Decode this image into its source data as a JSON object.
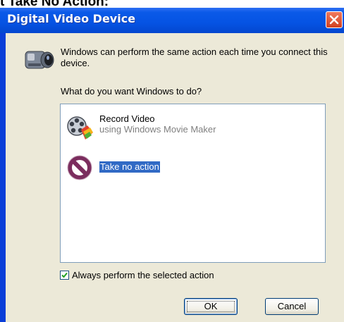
{
  "background_caption": "t Take No Action:",
  "dialog": {
    "title": "Digital Video Device",
    "message": "Windows can perform the same action each time you connect this device.",
    "question": "What do you want Windows to do?",
    "actions": [
      {
        "title": "Record Video",
        "subtitle": "using Windows Movie Maker",
        "icon": "movie-maker-icon",
        "selected": false
      },
      {
        "title": "Take no action",
        "icon": "no-action-icon",
        "selected": true
      }
    ],
    "always_checkbox": {
      "label": "Always perform the selected action",
      "checked": true
    },
    "ok_label": "OK",
    "cancel_label": "Cancel"
  },
  "colors": {
    "titlebar": "#0553e3",
    "selection": "#316ac5",
    "close_button": "#d2401f",
    "client_bg": "#ece9d8"
  }
}
